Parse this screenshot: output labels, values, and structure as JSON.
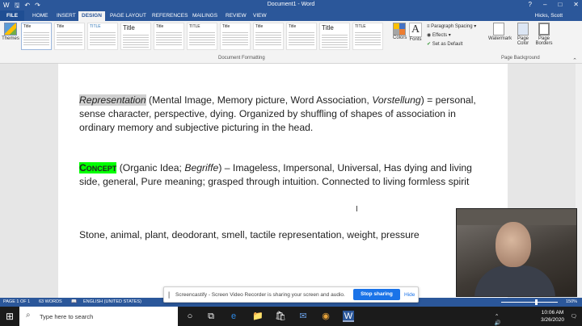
{
  "window": {
    "title": "Document1 - Word",
    "user": "Hicks, Scott"
  },
  "tabs": [
    "FILE",
    "HOME",
    "INSERT",
    "DESIGN",
    "PAGE LAYOUT",
    "REFERENCES",
    "MAILINGS",
    "REVIEW",
    "VIEW"
  ],
  "ribbon": {
    "themes_label": "Themes",
    "styles": [
      "Title",
      "Title",
      "TITLE",
      "Title",
      "Title",
      "TITLE",
      "Title",
      "Title",
      "Title",
      "Title",
      "TITLE"
    ],
    "group_document_formatting": "Document Formatting",
    "colors_label": "Colors",
    "fonts_label": "Fonts",
    "paragraph_spacing": "Paragraph Spacing",
    "effects": "Effects",
    "set_as_default": "Set as Default",
    "watermark": "Watermark",
    "page_color": "Page Color",
    "page_borders": "Page Borders",
    "group_page_background": "Page Background"
  },
  "document": {
    "p1": {
      "term": "Representation",
      "open": " (Mental Image, Memory picture, Word Association, ",
      "italic": "Vorstellung",
      "rest": ") = personal, sense character, perspective, dying. Organized by shuffling of shapes of association in ordinary memory and subjective picturing in the head."
    },
    "p2": {
      "term": "Concept",
      "open": " (Organic Idea; ",
      "italic": "Begriffe",
      "rest": ") – Imageless, Impersonal, Universal, Has dying and living side, general, Pure meaning; grasped through intuition. Connected to living formless spirit"
    },
    "p3": "Stone, animal, plant, deodorant, smell, tactile representation, weight, pressure"
  },
  "status": {
    "page": "PAGE 1 OF 1",
    "words": "63 WORDS",
    "language": "ENGLISH (UNITED STATES)",
    "zoom": "150%"
  },
  "screencastify": {
    "message": "Screencastify - Screen Video Recorder is sharing your screen and audio.",
    "stop": "Stop sharing",
    "hide": "Hide"
  },
  "taskbar": {
    "search_placeholder": "Type here to search",
    "time": "10:06 AM",
    "date": "3/26/2020"
  },
  "colors": {
    "word_blue": "#2b579a",
    "highlight_green": "#00ff00",
    "highlight_gray": "#d0d0d0",
    "share_blue": "#1a73e8"
  }
}
